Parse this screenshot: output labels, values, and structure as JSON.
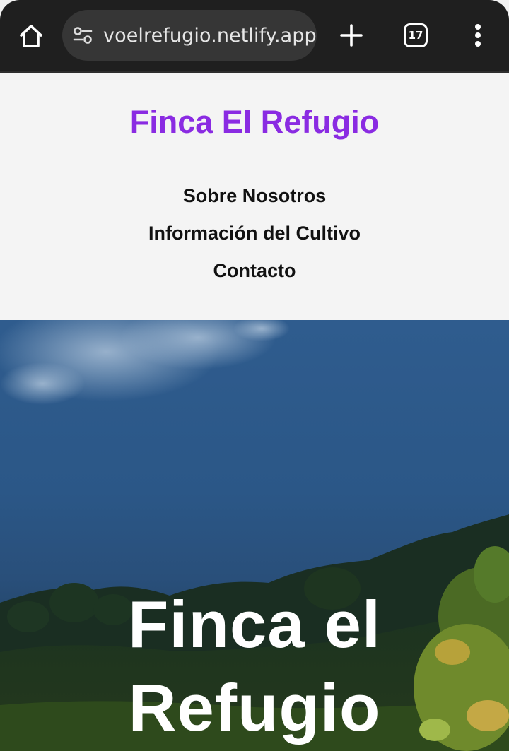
{
  "browser": {
    "url": "voelrefugio.netlify.app",
    "tab_count": "17",
    "icons": [
      "home-icon",
      "site-settings-icon",
      "new-tab-icon",
      "tab-switcher-icon",
      "more-vert-icon"
    ]
  },
  "header": {
    "title": "Finca El Refugio",
    "title_color": "#8a2be2"
  },
  "nav": {
    "items": [
      {
        "label": "Sobre Nosotros"
      },
      {
        "label": "Información del Cultivo"
      },
      {
        "label": "Contacto"
      }
    ]
  },
  "hero": {
    "title_line1": "Finca el",
    "title_line2": "Refugio"
  }
}
